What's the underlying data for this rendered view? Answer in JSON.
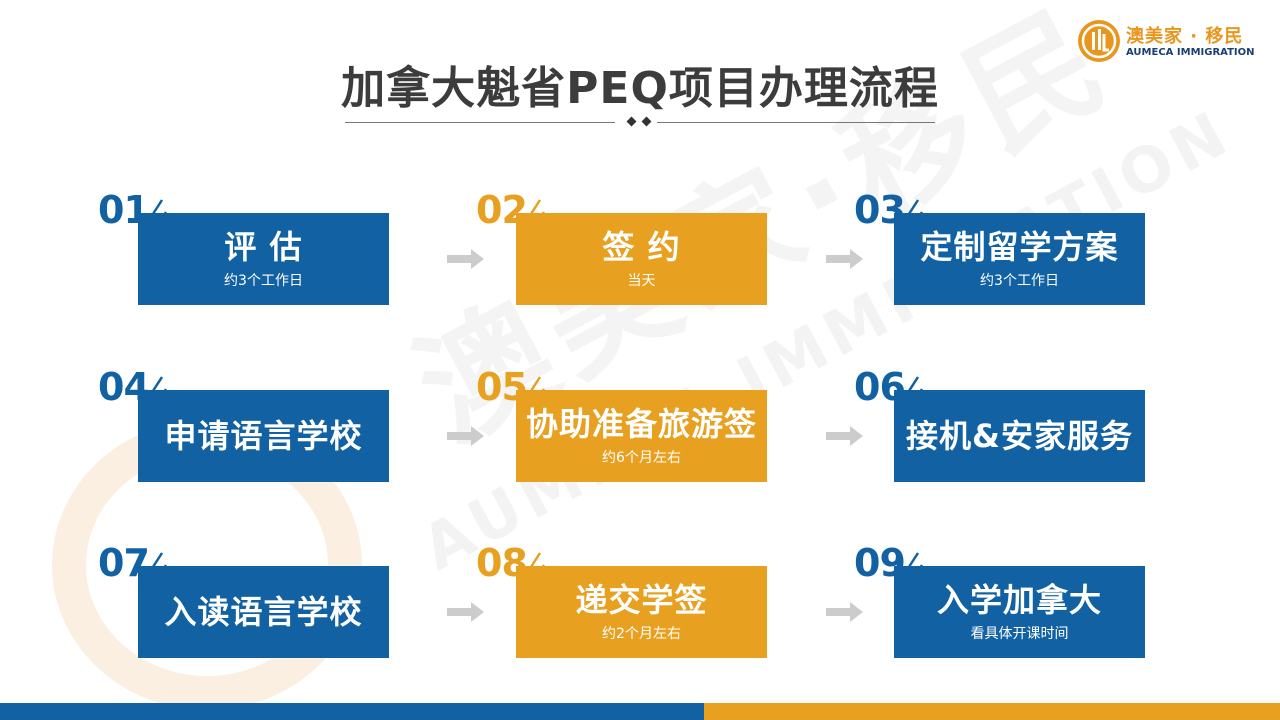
{
  "logo": {
    "cn": "澳美家 · 移民",
    "en": "AUMECA IMMIGRATION"
  },
  "watermark": {
    "cn": "澳美家·移民",
    "en": "AUMECA IMMIGRATION"
  },
  "title": "加拿大魁省PEQ项目办理流程",
  "colors": {
    "blue": "#1262a3",
    "orange": "#e8a020",
    "arrow": "#cccccc"
  },
  "steps": [
    {
      "num": "01",
      "title": "评 估",
      "sub": "约3个工作日",
      "color": "blue"
    },
    {
      "num": "02",
      "title": "签 约",
      "sub": "当天",
      "color": "orange"
    },
    {
      "num": "03",
      "title": "定制留学方案",
      "sub": "约3个工作日",
      "color": "blue"
    },
    {
      "num": "04",
      "title": "申请语言学校",
      "sub": "",
      "color": "blue"
    },
    {
      "num": "05",
      "title": "协助准备旅游签",
      "sub": "约6个月左右",
      "color": "orange"
    },
    {
      "num": "06",
      "title": "接机&安家服务",
      "sub": "",
      "color": "blue"
    },
    {
      "num": "07",
      "title": "入读语言学校",
      "sub": "",
      "color": "blue"
    },
    {
      "num": "08",
      "title": "递交学签",
      "sub": "约2个月左右",
      "color": "orange"
    },
    {
      "num": "09",
      "title": "入学加拿大",
      "sub": "看具体开课时间",
      "color": "blue"
    }
  ]
}
